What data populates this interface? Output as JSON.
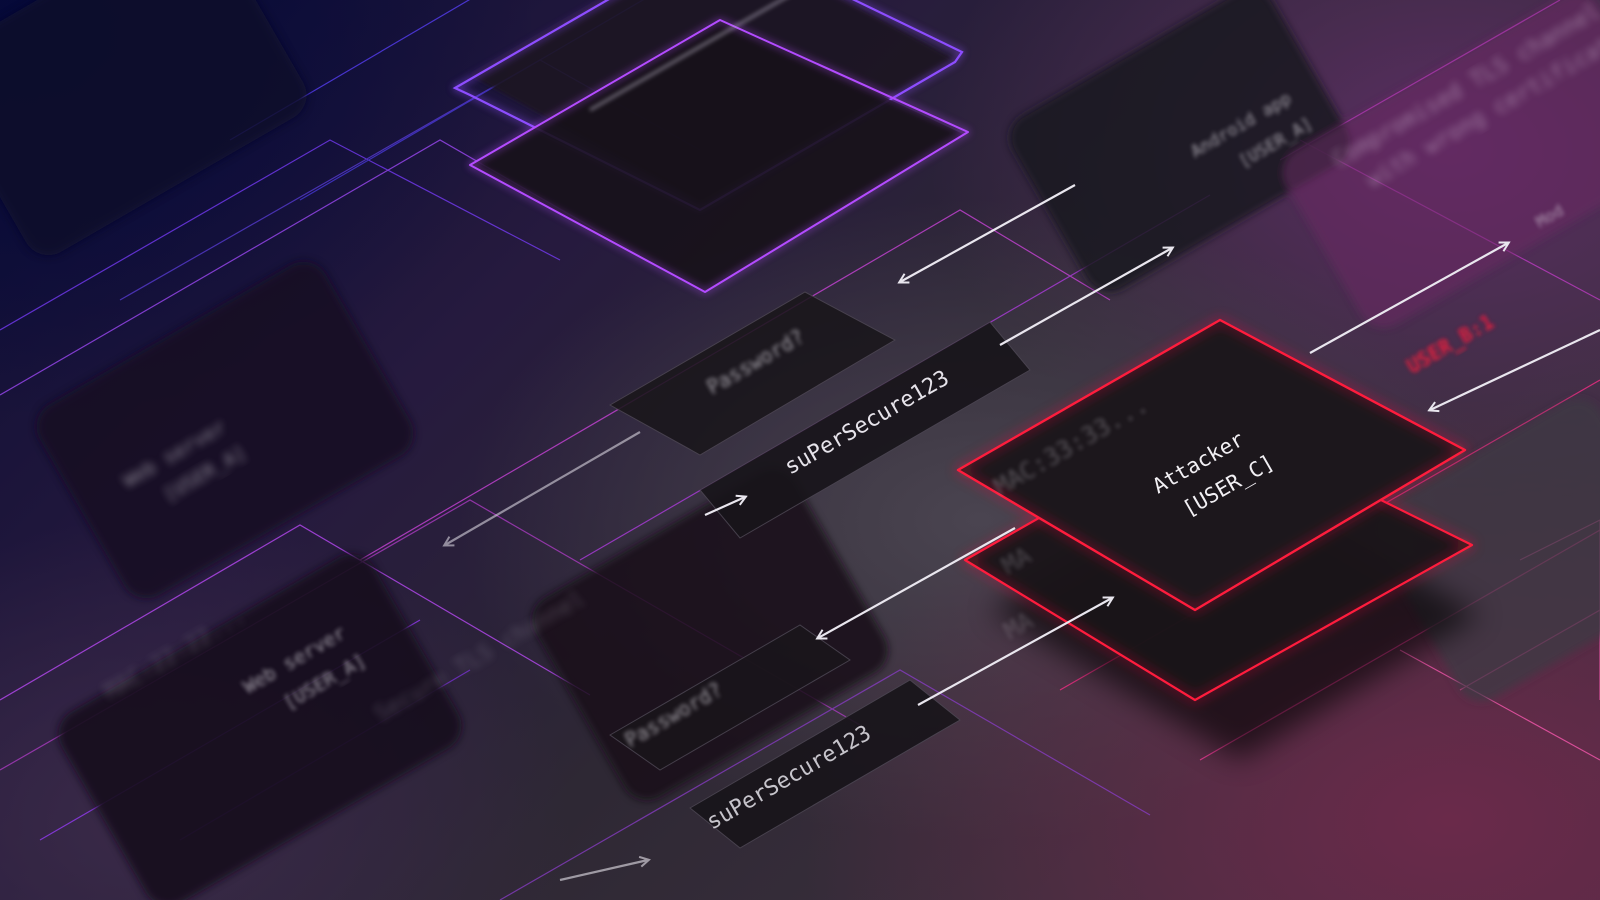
{
  "labels": {
    "attacker_name": "Attacker",
    "attacker_user": "[USER_C]",
    "attacker_mac": "MAC:33:33...",
    "mac_partial_upper": "MA",
    "mac_partial_lower": "MA",
    "password_prompt_top": "Password?",
    "password_value_top": "suPerSecure123",
    "password_prompt_bottom": "Password?",
    "password_value_bottom": "suPerSecure123",
    "web_server_upper": "Web server",
    "web_server_upper_user": "[USER_A]",
    "web_server_lower": "Web server",
    "web_server_lower_user": "[USER_A]",
    "web_server_lower_mac": "MAC:22:22...",
    "android_app": "Android app",
    "android_app_user": "[USER_A]",
    "compromised_line1": "Compromised TLS channel",
    "compromised_line2": "with wrong certificate",
    "user_b_tag": "USER_B:1",
    "secure_channel": "Secure TLS channel",
    "cut_label_right": "Mod"
  },
  "colors": {
    "attacker_accent": "#ff1e3c",
    "violet_accent": "#9a4dff",
    "magenta_accent": "#e23cc8",
    "arrow": "#e9e6ee",
    "card_fill": "#17141a"
  }
}
